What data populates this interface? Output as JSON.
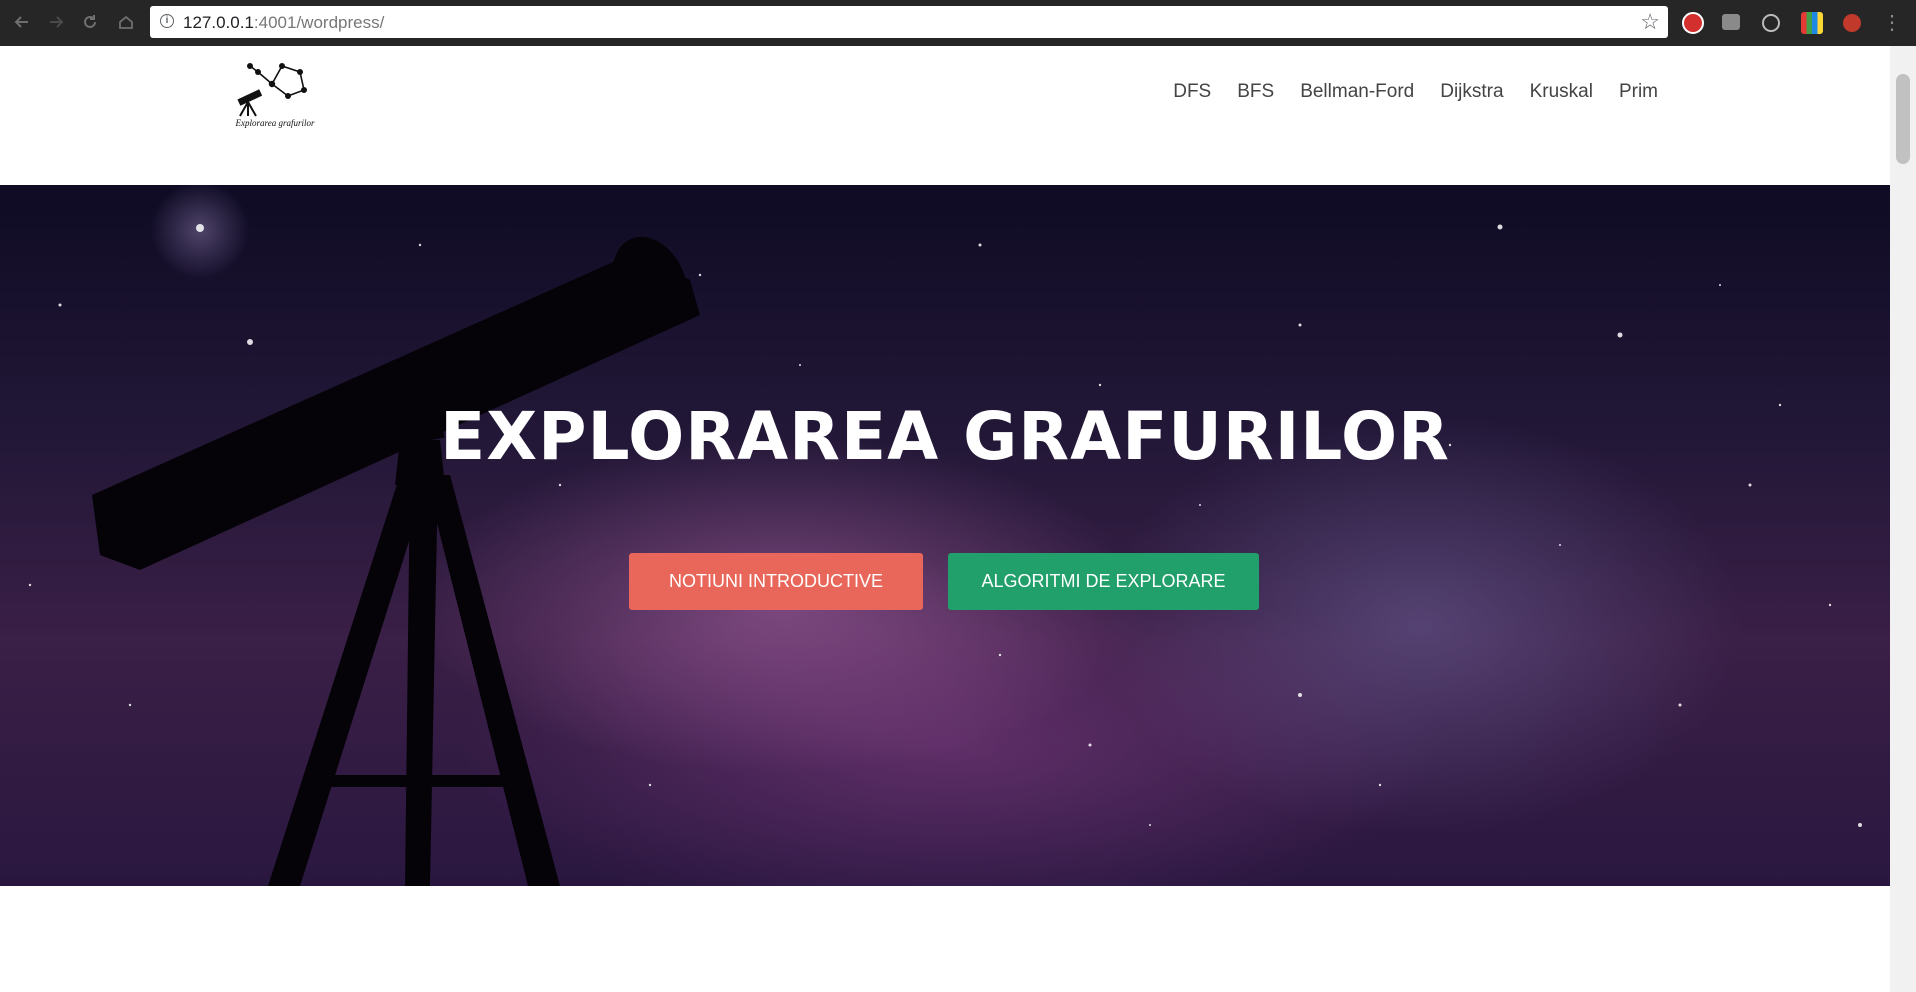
{
  "browser": {
    "url_host": "127.0.0.1",
    "url_rest": ":4001/wordpress/",
    "icons": [
      "back-arrow-icon",
      "forward-arrow-icon",
      "reload-icon",
      "home-icon",
      "info-icon",
      "bookmark-star-icon",
      "extension-adblock-icon",
      "extension-chat-icon",
      "extension-podcast-icon",
      "extension-s-icon",
      "extension-red-icon",
      "browser-menu-icon"
    ]
  },
  "site": {
    "logo_caption": "Explorarea grafurilor",
    "nav": [
      "DFS",
      "BFS",
      "Bellman-Ford",
      "Dijkstra",
      "Kruskal",
      "Prim"
    ]
  },
  "hero": {
    "title": "EXPLORAREA GRAFURILOR",
    "button_intro": "NOTIUNI INTRODUCTIVE",
    "button_algo": "ALGORITMI DE EXPLORARE"
  },
  "colors": {
    "intro_button": "#e8675a",
    "algo_button": "#22a06b",
    "nav_text": "#444444",
    "chrome": "#262626"
  }
}
